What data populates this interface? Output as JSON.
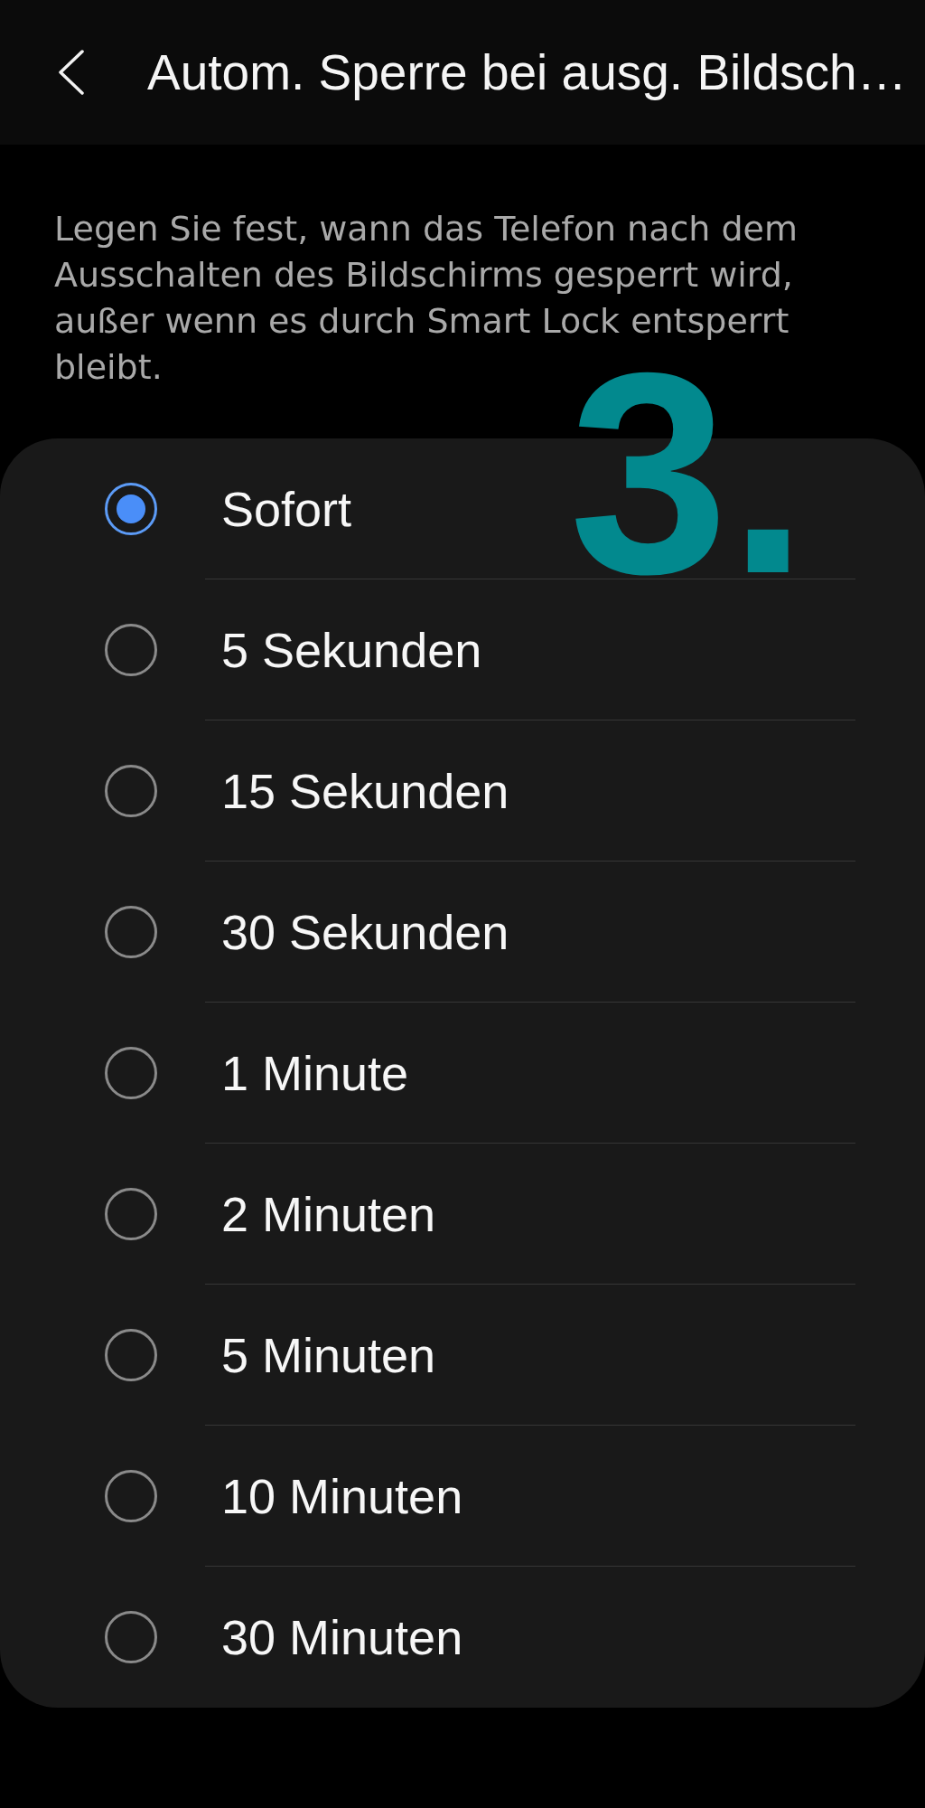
{
  "header": {
    "title": "Autom. Sperre bei ausg. Bildsch…"
  },
  "description": "Legen Sie fest, wann das Telefon nach dem Ausschalten des Bildschirms gesperrt wird, außer wenn es durch Smart Lock entsperrt bleibt.",
  "options": [
    {
      "label": "Sofort",
      "selected": true
    },
    {
      "label": "5 Sekunden",
      "selected": false
    },
    {
      "label": "15 Sekunden",
      "selected": false
    },
    {
      "label": "30 Sekunden",
      "selected": false
    },
    {
      "label": "1 Minute",
      "selected": false
    },
    {
      "label": "2 Minuten",
      "selected": false
    },
    {
      "label": "5 Minuten",
      "selected": false
    },
    {
      "label": "10 Minuten",
      "selected": false
    },
    {
      "label": "30 Minuten",
      "selected": false
    }
  ],
  "step_number": "3."
}
